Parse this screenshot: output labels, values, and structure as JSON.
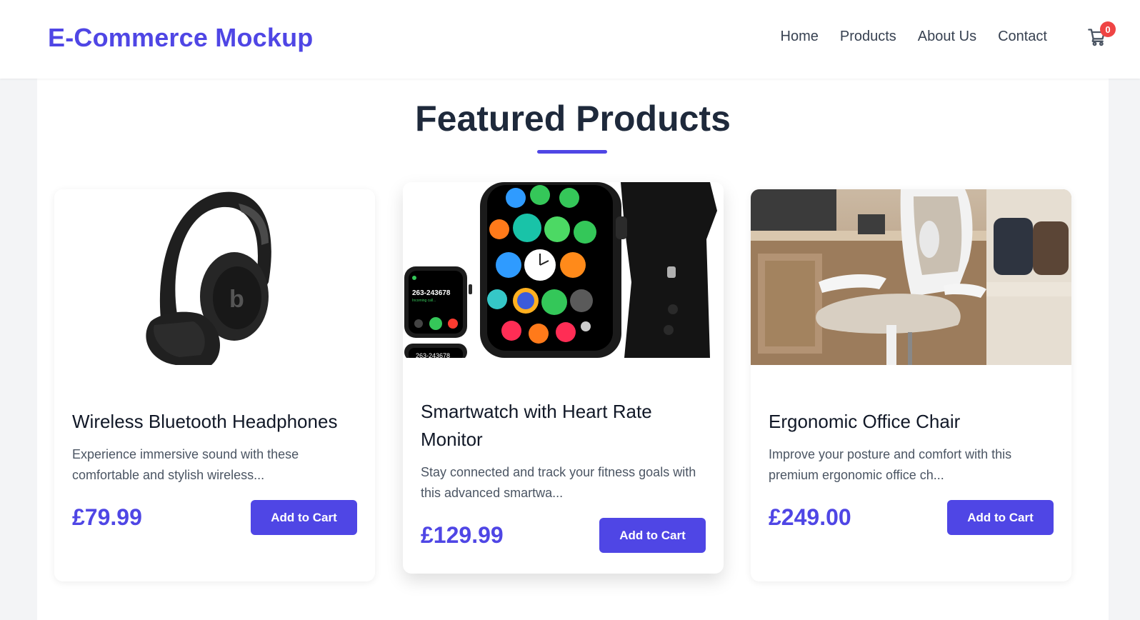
{
  "header": {
    "brand": "E-Commerce Mockup",
    "nav": [
      "Home",
      "Products",
      "About Us",
      "Contact"
    ],
    "cart_count": "0"
  },
  "main": {
    "title": "Featured Products",
    "products": [
      {
        "name": "Wireless Bluetooth Headphones",
        "description": "Experience immersive sound with these comfortable and stylish wireless...",
        "price": "£79.99",
        "button": "Add to Cart"
      },
      {
        "name": "Smartwatch with Heart Rate Monitor",
        "description": "Stay connected and track your fitness goals with this advanced smartwa...",
        "price": "£129.99",
        "button": "Add to Cart",
        "watch_screen": "263-243678",
        "watch_screen_sub": "Incoming call..."
      },
      {
        "name": "Ergonomic Office Chair",
        "description": "Improve your posture and comfort with this premium ergonomic office ch...",
        "price": "£249.00",
        "button": "Add to Cart"
      }
    ]
  },
  "colors": {
    "accent": "#4f46e5",
    "badge": "#ef4444"
  }
}
